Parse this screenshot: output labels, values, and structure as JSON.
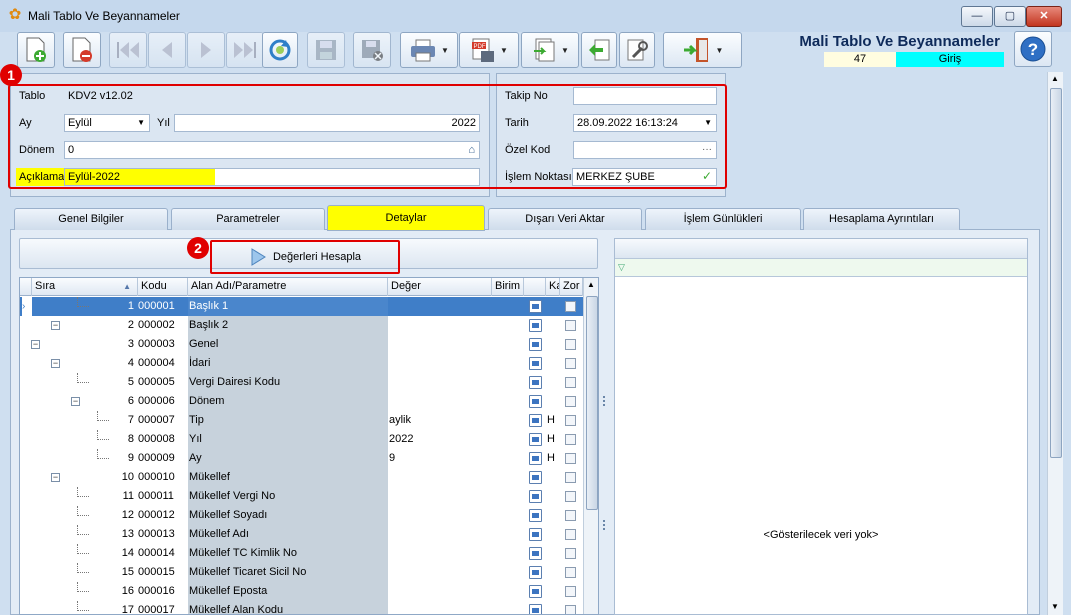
{
  "window": {
    "title": "Mali Tablo Ve Beyannameler",
    "controls": {
      "minimize": "—",
      "maximize": "▢",
      "close": "✕"
    }
  },
  "header": {
    "module_title": "Mali Tablo Ve Beyannameler",
    "record_no": "47",
    "mode": "Giriş",
    "help": "?"
  },
  "toolbar": {
    "icons": [
      "new-document-icon",
      "delete-document-icon",
      "first-record-icon",
      "previous-record-icon",
      "next-record-icon",
      "last-record-icon",
      "refresh-icon",
      "save-icon",
      "save-cancel-icon",
      "print-icon",
      "pdf-export-icon",
      "import-icon",
      "back-icon",
      "tools-icon",
      "exit-icon"
    ]
  },
  "form": {
    "tablo_label": "Tablo",
    "tablo_value": "KDV2 v12.02",
    "ay_label": "Ay",
    "ay_value": "Eylül",
    "yil_label": "Yıl",
    "yil_value": "2022",
    "donem_label": "Dönem",
    "donem_value": "0",
    "aciklama_label": "Açıklama",
    "aciklama_value": "Eylül-2022",
    "takipno_label": "Takip No",
    "takipno_value": "",
    "tarih_label": "Tarih",
    "tarih_value": "28.09.2022 16:13:24",
    "ozelkod_label": "Özel Kod",
    "ozelkod_value": "",
    "islemnoktasi_label": "İşlem Noktası",
    "islemnoktasi_value": "MERKEZ ŞUBE"
  },
  "annotations": {
    "marker1": "1",
    "marker2": "2"
  },
  "tabs": [
    {
      "label": "Genel Bilgiler"
    },
    {
      "label": "Parametreler"
    },
    {
      "label": "Detaylar"
    },
    {
      "label": "Dışarı Veri Aktar"
    },
    {
      "label": "İşlem Günlükleri"
    },
    {
      "label": "Hesaplama Ayrıntıları"
    }
  ],
  "calc_button": {
    "label": "Değerleri Hesapla"
  },
  "grid": {
    "columns": {
      "sira": "Sıra",
      "kodu": "Kodu",
      "alan": "Alan Adı/Parametre",
      "deger": "Değer",
      "birim": "Birim",
      "ka": "Ka",
      "zor": "Zor"
    },
    "rows": [
      {
        "sira": "1",
        "kodu": "000001",
        "name": "Başlık 1",
        "deger": "",
        "ka": ""
      },
      {
        "sira": "2",
        "kodu": "000002",
        "name": "Başlık 2",
        "deger": "",
        "ka": ""
      },
      {
        "sira": "3",
        "kodu": "000003",
        "name": "Genel",
        "deger": "",
        "ka": ""
      },
      {
        "sira": "4",
        "kodu": "000004",
        "name": "İdari",
        "deger": "",
        "ka": ""
      },
      {
        "sira": "5",
        "kodu": "000005",
        "name": "Vergi Dairesi Kodu",
        "deger": "",
        "ka": ""
      },
      {
        "sira": "6",
        "kodu": "000006",
        "name": "Dönem",
        "deger": "",
        "ka": ""
      },
      {
        "sira": "7",
        "kodu": "000007",
        "name": "Tip",
        "deger": "aylik",
        "ka": "H"
      },
      {
        "sira": "8",
        "kodu": "000008",
        "name": "Yıl",
        "deger": "2022",
        "ka": "H"
      },
      {
        "sira": "9",
        "kodu": "000009",
        "name": "Ay",
        "deger": "9",
        "ka": "H"
      },
      {
        "sira": "10",
        "kodu": "000010",
        "name": "Mükellef",
        "deger": "",
        "ka": ""
      },
      {
        "sira": "11",
        "kodu": "000011",
        "name": "Mükellef Vergi No",
        "deger": "",
        "ka": ""
      },
      {
        "sira": "12",
        "kodu": "000012",
        "name": "Mükellef Soyadı",
        "deger": "",
        "ka": ""
      },
      {
        "sira": "13",
        "kodu": "000013",
        "name": "Mükellef Adı",
        "deger": "",
        "ka": ""
      },
      {
        "sira": "14",
        "kodu": "000014",
        "name": "Mükellef TC Kimlik No",
        "deger": "",
        "ka": ""
      },
      {
        "sira": "15",
        "kodu": "000015",
        "name": "Mükellef Ticaret Sicil No",
        "deger": "",
        "ka": ""
      },
      {
        "sira": "16",
        "kodu": "000016",
        "name": "Mükellef Eposta",
        "deger": "",
        "ka": ""
      },
      {
        "sira": "17",
        "kodu": "000017",
        "name": "Mükellef Alan Kodu",
        "deger": "",
        "ka": ""
      }
    ]
  },
  "right_pane": {
    "empty_text": "<Gösterilecek veri yok>"
  },
  "colors": {
    "highlight": "#ffff00",
    "annotation_red": "#e00000",
    "mode_badge": "#00ffff",
    "selected_row": "#3f7ec8"
  }
}
